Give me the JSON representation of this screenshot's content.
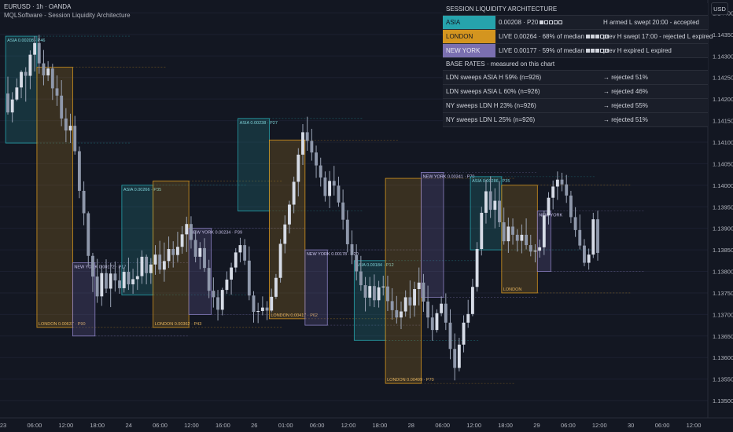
{
  "symbol_line": "EURUSD · 1h · OANDA",
  "indicator_line": "MQLSoftware - Session Liquidity Architecture",
  "currency_button": "USD",
  "panel": {
    "title": "SESSION LIQUIDITY ARCHITECTURE",
    "sessions": [
      {
        "name": "ASIA",
        "value": "0.00208 · P20",
        "bars_filled": 1,
        "state": "H armed   L swept 20:00 - accepted",
        "color": "#26a3ac",
        "text_color": "#131722"
      },
      {
        "name": "LONDON",
        "value": "LIVE  0.00264 · 68% of median",
        "bars_filled": 3,
        "state": "prev  H swept 17:00 - rejected   L expired",
        "color": "#d4951f",
        "text_color": "#131722"
      },
      {
        "name": "NEW YORK",
        "value": "LIVE  0.00177 · 59% of median",
        "bars_filled": 3,
        "state": "prev  H expired   L expired",
        "color": "#7a6fb0",
        "text_color": "#e8e8f0"
      }
    ],
    "base_rates_title": "BASE RATES · measured on this chart",
    "base_rates": [
      {
        "label": "LDN sweeps ASIA H   59%  (n=926)",
        "result": "→ rejected 51%"
      },
      {
        "label": "LDN sweeps ASIA L   60%  (n=926)",
        "result": "→ rejected 46%"
      },
      {
        "label": "NY sweeps LDN H   23%  (n=926)",
        "result": "→ rejected 55%"
      },
      {
        "label": "NY sweeps LDN L   25%  (n=926)",
        "result": "→ rejected 51%"
      }
    ]
  },
  "chart_data": {
    "type": "candlestick",
    "y_range": [
      1.1346,
      1.1443
    ],
    "y_ticks": [
      "1.14400",
      "1.14350",
      "1.14300",
      "1.14250",
      "1.14200",
      "1.14150",
      "1.14100",
      "1.14050",
      "1.14000",
      "1.13950",
      "1.13900",
      "1.13850",
      "1.13800",
      "1.13750",
      "1.13700",
      "1.13650",
      "1.13600",
      "1.13550",
      "1.13500"
    ],
    "x_ticks": [
      "23",
      "06:00",
      "12:00",
      "18:00",
      "24",
      "06:00",
      "12:00",
      "16:00",
      "26",
      "01:00",
      "06:00",
      "12:00",
      "18:00",
      "28",
      "06:00",
      "12:00",
      "18:00",
      "29",
      "06:00",
      "12:00",
      "30",
      "06:00",
      "12:00"
    ],
    "candles": [
      [
        1.14213,
        1.14252,
        1.14164,
        1.14169
      ],
      [
        1.14169,
        1.14216,
        1.14146,
        1.14199
      ],
      [
        1.14199,
        1.14248,
        1.14195,
        1.14227
      ],
      [
        1.14227,
        1.14267,
        1.14202,
        1.14263
      ],
      [
        1.14263,
        1.14274,
        1.14194,
        1.14254
      ],
      [
        1.14254,
        1.14313,
        1.14223,
        1.14303
      ],
      [
        1.14303,
        1.14346,
        1.14264,
        1.1433
      ],
      [
        1.1433,
        1.14349,
        1.14259,
        1.14283
      ],
      [
        1.14283,
        1.14314,
        1.14232,
        1.14255
      ],
      [
        1.14255,
        1.14288,
        1.14242,
        1.14271
      ],
      [
        1.14271,
        1.14282,
        1.14198,
        1.14225
      ],
      [
        1.14225,
        1.14255,
        1.14184,
        1.14208
      ],
      [
        1.14208,
        1.14244,
        1.14137,
        1.14155
      ],
      [
        1.14155,
        1.14179,
        1.141,
        1.14127
      ],
      [
        1.14127,
        1.14166,
        1.14098,
        1.14138
      ],
      [
        1.14138,
        1.14161,
        1.14071,
        1.14079
      ],
      [
        1.14079,
        1.1409,
        1.1397,
        1.13987
      ],
      [
        1.13987,
        1.14009,
        1.13907,
        1.13935
      ],
      [
        1.13935,
        1.13939,
        1.13813,
        1.13836
      ],
      [
        1.13836,
        1.13843,
        1.13752,
        1.13788
      ],
      [
        1.13788,
        1.13829,
        1.13727,
        1.13742
      ],
      [
        1.13742,
        1.13815,
        1.1372,
        1.13796
      ],
      [
        1.13796,
        1.13828,
        1.1375,
        1.1376
      ],
      [
        1.1376,
        1.1382,
        1.13717,
        1.13795
      ],
      [
        1.13795,
        1.13823,
        1.13753,
        1.13779
      ],
      [
        1.13779,
        1.1381,
        1.13748,
        1.13761
      ],
      [
        1.13761,
        1.13809,
        1.13751,
        1.13799
      ],
      [
        1.13799,
        1.13832,
        1.13757,
        1.1377
      ],
      [
        1.1377,
        1.13806,
        1.13748,
        1.13782
      ],
      [
        1.13782,
        1.13831,
        1.13757,
        1.13789
      ],
      [
        1.13789,
        1.13849,
        1.13771,
        1.13834
      ],
      [
        1.13834,
        1.13839,
        1.1377,
        1.13796
      ],
      [
        1.13796,
        1.13831,
        1.13771,
        1.13816
      ],
      [
        1.13816,
        1.13861,
        1.13792,
        1.13839
      ],
      [
        1.13839,
        1.13871,
        1.13794,
        1.13804
      ],
      [
        1.13804,
        1.13867,
        1.13776,
        1.13824
      ],
      [
        1.13824,
        1.13881,
        1.13808,
        1.13852
      ],
      [
        1.13852,
        1.1387,
        1.13809,
        1.13838
      ],
      [
        1.13838,
        1.13892,
        1.13822,
        1.13857
      ],
      [
        1.13857,
        1.13905,
        1.13841,
        1.13886
      ],
      [
        1.13886,
        1.13927,
        1.13845,
        1.1391
      ],
      [
        1.1391,
        1.13928,
        1.13853,
        1.13873
      ],
      [
        1.13873,
        1.13895,
        1.13821,
        1.13834
      ],
      [
        1.13834,
        1.13868,
        1.13805,
        1.13854
      ],
      [
        1.13854,
        1.13877,
        1.13799,
        1.13808
      ],
      [
        1.13808,
        1.13827,
        1.13738,
        1.13755
      ],
      [
        1.13755,
        1.13786,
        1.13716,
        1.1374
      ],
      [
        1.1374,
        1.13757,
        1.13686,
        1.13711
      ],
      [
        1.13711,
        1.13762,
        1.13698,
        1.13757
      ],
      [
        1.13757,
        1.138,
        1.13748,
        1.13781
      ],
      [
        1.13781,
        1.1382,
        1.13746,
        1.13809
      ],
      [
        1.13809,
        1.13854,
        1.13798,
        1.13844
      ],
      [
        1.13844,
        1.13878,
        1.13821,
        1.13861
      ],
      [
        1.13861,
        1.13875,
        1.13815,
        1.13825
      ],
      [
        1.13825,
        1.13858,
        1.13733,
        1.13744
      ],
      [
        1.13744,
        1.13754,
        1.13681,
        1.13706
      ],
      [
        1.13706,
        1.13727,
        1.1368,
        1.13708
      ],
      [
        1.13708,
        1.13742,
        1.13698,
        1.13716
      ],
      [
        1.13716,
        1.13731,
        1.13687,
        1.13709
      ],
      [
        1.13709,
        1.1376,
        1.13705,
        1.13741
      ],
      [
        1.13741,
        1.13794,
        1.13736,
        1.13785
      ],
      [
        1.13785,
        1.13875,
        1.13774,
        1.13864
      ],
      [
        1.13864,
        1.1393,
        1.13842,
        1.13909
      ],
      [
        1.13909,
        1.13964,
        1.13888,
        1.13955
      ],
      [
        1.13955,
        1.1402,
        1.13935,
        1.14008
      ],
      [
        1.14008,
        1.14086,
        1.13974,
        1.14071
      ],
      [
        1.14071,
        1.14142,
        1.14047,
        1.14123
      ],
      [
        1.14123,
        1.14159,
        1.1408,
        1.14103
      ],
      [
        1.14103,
        1.14131,
        1.14057,
        1.14076
      ],
      [
        1.14076,
        1.14092,
        1.14017,
        1.14046
      ],
      [
        1.14046,
        1.14064,
        1.13997,
        1.14018
      ],
      [
        1.14018,
        1.14032,
        1.13962,
        1.13975
      ],
      [
        1.13975,
        1.14033,
        1.13947,
        1.1401
      ],
      [
        1.1401,
        1.14045,
        1.13976,
        1.13999
      ],
      [
        1.13999,
        1.1402,
        1.1395,
        1.1396
      ],
      [
        1.1396,
        1.1399,
        1.13897,
        1.1392
      ],
      [
        1.1392,
        1.13942,
        1.13844,
        1.13863
      ],
      [
        1.13863,
        1.13895,
        1.13817,
        1.13838
      ],
      [
        1.13838,
        1.13863,
        1.13779,
        1.138
      ],
      [
        1.138,
        1.13836,
        1.13755,
        1.13768
      ],
      [
        1.13768,
        1.13787,
        1.13707,
        1.13739
      ],
      [
        1.13739,
        1.13787,
        1.13719,
        1.13766
      ],
      [
        1.13766,
        1.13793,
        1.13717,
        1.13733
      ],
      [
        1.13733,
        1.13778,
        1.13716,
        1.13763
      ],
      [
        1.13763,
        1.1379,
        1.13744,
        1.13765
      ],
      [
        1.13765,
        1.1379,
        1.13708,
        1.13731
      ],
      [
        1.13731,
        1.13761,
        1.13688,
        1.1371
      ],
      [
        1.1371,
        1.13743,
        1.13679,
        1.13693
      ],
      [
        1.13693,
        1.1373,
        1.13666,
        1.13707
      ],
      [
        1.13707,
        1.13756,
        1.13695,
        1.1374
      ],
      [
        1.1374,
        1.13779,
        1.13691,
        1.13721
      ],
      [
        1.13721,
        1.13776,
        1.13695,
        1.13759
      ],
      [
        1.13759,
        1.13809,
        1.13721,
        1.13774
      ],
      [
        1.13774,
        1.13794,
        1.13706,
        1.1373
      ],
      [
        1.1373,
        1.13767,
        1.13668,
        1.13693
      ],
      [
        1.13693,
        1.13722,
        1.13639,
        1.13664
      ],
      [
        1.13664,
        1.13712,
        1.13658,
        1.13703
      ],
      [
        1.13703,
        1.13742,
        1.13696,
        1.13725
      ],
      [
        1.13725,
        1.13749,
        1.13664,
        1.13681
      ],
      [
        1.13681,
        1.13712,
        1.13596,
        1.1362
      ],
      [
        1.1362,
        1.13656,
        1.13547,
        1.13576
      ],
      [
        1.13576,
        1.13646,
        1.13568,
        1.1363
      ],
      [
        1.1363,
        1.13698,
        1.13612,
        1.13681
      ],
      [
        1.13681,
        1.13734,
        1.13669,
        1.13701
      ],
      [
        1.13701,
        1.13783,
        1.13696,
        1.13764
      ],
      [
        1.13764,
        1.13868,
        1.13753,
        1.13852
      ],
      [
        1.13852,
        1.1395,
        1.13837,
        1.13936
      ],
      [
        1.13936,
        1.14013,
        1.13911,
        1.13986
      ],
      [
        1.13986,
        1.14021,
        1.13924,
        1.13943
      ],
      [
        1.13943,
        1.13993,
        1.139,
        1.13964
      ],
      [
        1.13964,
        1.14009,
        1.13903,
        1.13914
      ],
      [
        1.13914,
        1.13948,
        1.13862,
        1.1387
      ],
      [
        1.1387,
        1.13925,
        1.13843,
        1.13904
      ],
      [
        1.13904,
        1.13923,
        1.13862,
        1.13885
      ],
      [
        1.13885,
        1.13898,
        1.13846,
        1.13871
      ],
      [
        1.13871,
        1.13909,
        1.13842,
        1.13885
      ],
      [
        1.13885,
        1.13923,
        1.13851,
        1.13861
      ],
      [
        1.13861,
        1.13885,
        1.13835,
        1.13846
      ],
      [
        1.13846,
        1.13863,
        1.13821,
        1.13848
      ],
      [
        1.13848,
        1.13874,
        1.13832,
        1.13856
      ],
      [
        1.13856,
        1.13941,
        1.13838,
        1.1393
      ],
      [
        1.1393,
        1.13984,
        1.13909,
        1.13971
      ],
      [
        1.13971,
        1.14011,
        1.13944,
        1.13997
      ],
      [
        1.13997,
        1.14032,
        1.13966,
        1.14013
      ],
      [
        1.14013,
        1.14029,
        1.13986,
        1.14002
      ],
      [
        1.14002,
        1.14024,
        1.13959,
        1.13976
      ],
      [
        1.13976,
        1.13987,
        1.13912,
        1.13926
      ],
      [
        1.13926,
        1.13949,
        1.1388,
        1.13896
      ],
      [
        1.13896,
        1.13932,
        1.13851,
        1.1386
      ],
      [
        1.1386,
        1.13875,
        1.13812,
        1.1382
      ],
      [
        1.1382,
        1.13853,
        1.13804,
        1.13839
      ],
      [
        1.13839,
        1.13936,
        1.13831,
        1.13921
      ],
      [
        1.13921,
        1.13941,
        1.13825,
        1.13843
      ]
    ],
    "sessions": [
      {
        "kind": "ASIA",
        "label": "ASIA  0.00208 · P46",
        "from": 0,
        "to": 6,
        "high": 1.14346,
        "low": 1.14098
      },
      {
        "kind": "LONDON",
        "label": "LONDON  0.00637 · P90",
        "from": 7,
        "to": 14,
        "high": 1.14274,
        "low": 1.1367
      },
      {
        "kind": "NEW YORK",
        "label": "NEW YORK  0.00172 · P17",
        "from": 15,
        "to": 19,
        "high": 1.1382,
        "low": 1.1365
      },
      {
        "kind": "ASIA",
        "label": "ASIA  0.00266 · P35",
        "from": 26,
        "to": 32,
        "high": 1.14,
        "low": 1.13745
      },
      {
        "kind": "LONDON",
        "label": "LONDON  0.00362 · P43",
        "from": 33,
        "to": 40,
        "high": 1.1401,
        "low": 1.1367
      },
      {
        "kind": "NEW YORK",
        "label": "NEW YORK  0.00234 · P39",
        "from": 41,
        "to": 45,
        "high": 1.139,
        "low": 1.137
      },
      {
        "kind": "ASIA",
        "label": "ASIA  0.00238 · P27",
        "from": 52,
        "to": 58,
        "high": 1.14155,
        "low": 1.1394
      },
      {
        "kind": "LONDON",
        "label": "LONDON  0.00417 · P62",
        "from": 59,
        "to": 66,
        "high": 1.14105,
        "low": 1.1369
      },
      {
        "kind": "NEW YORK",
        "label": "NEW YORK  0.00178 · P20",
        "from": 67,
        "to": 71,
        "high": 1.1385,
        "low": 1.13675
      },
      {
        "kind": "ASIA",
        "label": "ASIA  0.00184 · P12",
        "from": 78,
        "to": 84,
        "high": 1.13825,
        "low": 1.1364
      },
      {
        "kind": "LONDON",
        "label": "LONDON  0.00499 · P70",
        "from": 85,
        "to": 92,
        "high": 1.14016,
        "low": 1.1354
      },
      {
        "kind": "NEW YORK",
        "label": "NEW YORK  0.00341 · P70",
        "from": 93,
        "to": 97,
        "high": 1.1403,
        "low": 1.1374
      },
      {
        "kind": "ASIA",
        "label": "ASIA  0.00286 · P35",
        "from": 104,
        "to": 110,
        "high": 1.1402,
        "low": 1.1385
      },
      {
        "kind": "LONDON",
        "label": "LONDON",
        "from": 111,
        "to": 118,
        "high": 1.14,
        "low": 1.1375
      },
      {
        "kind": "NEW YORK",
        "label": "NEW YORK",
        "from": 119,
        "to": 121,
        "high": 1.1394,
        "low": 1.138
      }
    ]
  }
}
